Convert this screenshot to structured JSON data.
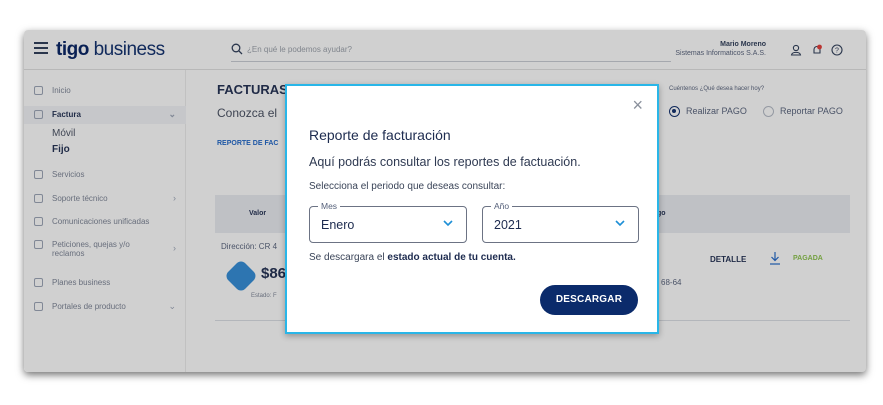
{
  "header": {
    "logo_brand": "tigo",
    "logo_suffix": "business",
    "search_placeholder": "¿En qué le podemos ayudar?",
    "user_name": "Mario Moreno",
    "user_company": "Sistemas Informaticos S.A.S."
  },
  "sidebar": {
    "items": [
      {
        "label": "Inicio"
      },
      {
        "label": "Factura"
      },
      {
        "label": "Servicios"
      },
      {
        "label": "Soporte técnico"
      },
      {
        "label": "Comunicaciones unificadas"
      },
      {
        "label": "Peticiones, quejas y/o reclamos"
      },
      {
        "label": "Planes business"
      },
      {
        "label": "Portales de producto"
      }
    ],
    "factura_sub": [
      "Móvil",
      "Fijo"
    ]
  },
  "main": {
    "title": "FACTURAS",
    "subtitle": "Conozca el",
    "report_link": "REPORTE DE FAC",
    "pay_question": "Cuéntenos ¿Qué desea hacer hoy?",
    "radio_pay": "Realizar PAGO",
    "radio_report": "Reportar PAGO",
    "col_valor": "Valor",
    "col_pago": "go",
    "row": {
      "direccion": "Dirección: CR 4",
      "amount": "$86,",
      "estado": "Estado: F",
      "ref": "68-64",
      "detalle": "DETALLE",
      "status": "PAGADA"
    }
  },
  "modal": {
    "close": "×",
    "title": "Reporte de facturación",
    "description": "Aquí podrás consultar los reportes de factuación.",
    "period_prompt": "Selecciona el periodo que deseas consultar:",
    "month_label": "Mes",
    "month_value": "Enero",
    "year_label": "Año",
    "year_value": "2021",
    "note_prefix": "Se descargara el",
    "note_bold": "estado actual de tu cuenta.",
    "download_button": "DESCARGAR"
  },
  "colors": {
    "brand_navy": "#0b2b6b",
    "accent_cyan": "#29b6e8",
    "status_green": "#8bc34a",
    "link_blue": "#1c64c8"
  }
}
